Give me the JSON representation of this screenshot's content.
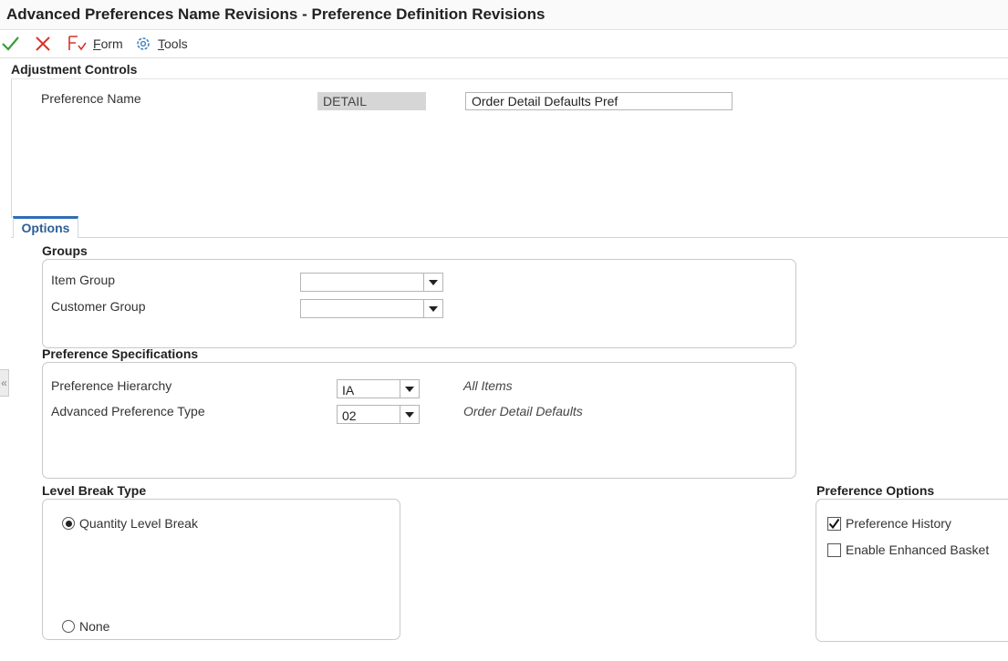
{
  "window": {
    "title": "Advanced Preferences Name Revisions - Preference Definition Revisions"
  },
  "toolbar": {
    "ok_icon": "check-icon",
    "cancel_icon": "close-icon",
    "form_label": "Form",
    "form_accel": "F",
    "form_rest": "orm",
    "tools_accel": "T",
    "tools_rest": "ools"
  },
  "adjustment_controls": {
    "heading": "Adjustment Controls",
    "preference_name_label": "Preference Name",
    "preference_code": "DETAIL",
    "preference_description": "Order Detail Defaults Pref"
  },
  "tabs": [
    {
      "label": "Options",
      "active": true
    }
  ],
  "groups": {
    "heading": "Groups",
    "item_group_label": "Item Group",
    "item_group_value": "",
    "customer_group_label": "Customer Group",
    "customer_group_value": ""
  },
  "preference_specifications": {
    "heading": "Preference Specifications",
    "hierarchy_label": "Preference Hierarchy",
    "hierarchy_value": "IA",
    "hierarchy_desc": "All Items",
    "type_label": "Advanced Preference Type",
    "type_value": "02",
    "type_desc": "Order Detail Defaults"
  },
  "level_break_type": {
    "heading": "Level Break Type",
    "options": [
      {
        "label": "Quantity Level Break",
        "selected": true
      },
      {
        "label": "None",
        "selected": false
      }
    ]
  },
  "preference_options": {
    "heading": "Preference Options",
    "options": [
      {
        "label": "Preference History",
        "checked": true
      },
      {
        "label": "Enable Enhanced Basket",
        "checked": false
      }
    ]
  },
  "colors": {
    "ok": "#3a9b3a",
    "cancel": "#d9322b",
    "tab_accent": "#2e6db4"
  }
}
